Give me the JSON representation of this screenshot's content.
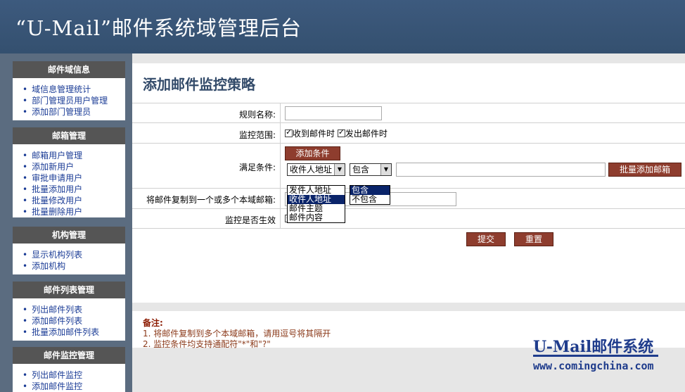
{
  "header": {
    "title": "“U-Mail”邮件系统域管理后台"
  },
  "sidebar": {
    "sections": [
      {
        "title": "邮件域信息",
        "items": [
          "域信息管理统计",
          "部门管理员用户管理",
          "添加部门管理员"
        ]
      },
      {
        "title": "邮箱管理",
        "items": [
          "邮箱用户管理",
          "添加新用户",
          "审批申请用户",
          "批量添加用户",
          "批量修改用户",
          "批量删除用户"
        ]
      },
      {
        "title": "机构管理",
        "items": [
          "显示机构列表",
          "添加机构"
        ]
      },
      {
        "title": "邮件列表管理",
        "items": [
          "列出邮件列表",
          "添加邮件列表",
          "批量添加邮件列表"
        ]
      },
      {
        "title": "邮件监控管理",
        "items": [
          "列出邮件监控",
          "添加邮件监控"
        ]
      }
    ]
  },
  "main": {
    "page_title": "添加邮件监控策略",
    "form": {
      "rule_name_label": "规则名称:",
      "rule_name_value": "",
      "scope_label": "监控范围:",
      "scope_received": "收到邮件时",
      "scope_sent": "发出邮件时",
      "condition_label": "满足条件:",
      "add_condition_button": "添加条件",
      "field_select_value": "收件人地址",
      "field_options": [
        "发件人地址",
        "收件人地址",
        "邮件主题",
        "邮件内容"
      ],
      "operator_select_value": "包含",
      "operator_options": [
        "包含",
        "不包含"
      ],
      "condition_value": "",
      "batch_add_button": "批量添加邮箱",
      "copy_label": "将邮件复制到一个或多个本域邮箱:",
      "copy_value": "",
      "enabled_label": "监控是否生效",
      "submit_button": "提交",
      "reset_button": "重置"
    },
    "notes": {
      "heading": "备注:",
      "lines": [
        "1.  将邮件复制到多个本域邮箱，请用逗号将其隔开",
        "2.  监控条件均支持通配符\"*\"和\"?\""
      ]
    }
  },
  "brand": {
    "name": "U-Mail邮件系统",
    "url": "www.comingchina.com"
  },
  "colors": {
    "header": "#3a5577",
    "sidebar_bg": "#5b6c80",
    "button": "#8e3d2e",
    "link": "#1b3c96",
    "title": "#334b6a",
    "brand": "#1f3c8c"
  }
}
